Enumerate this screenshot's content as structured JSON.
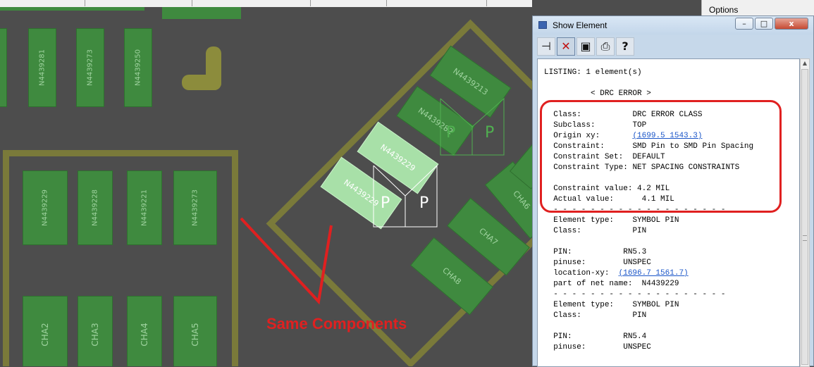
{
  "canvas": {
    "left_pads": [
      "N4439281",
      "N4439273",
      "N4439250"
    ],
    "middle_pads": [
      "N4439229",
      "N4439228",
      "N4439221",
      "N4439273"
    ],
    "bottom_pads": [
      "CHA2",
      "CHA3",
      "CHA4",
      "CHA5"
    ],
    "rotated_pads": {
      "highlighted": [
        "N4439229",
        "N4439229"
      ],
      "upper": [
        "N4439213",
        "N4439282"
      ],
      "cha": [
        "CHA6",
        "CHA7",
        "CHA8"
      ],
      "pin_glyph": "P"
    },
    "annotation": "Same Components",
    "colors": {
      "pad": "#3f8a3f",
      "highlight": "#a8e0a8",
      "outline": "#7a7a3a",
      "annotation": "#e02020"
    }
  },
  "options_label": "Options",
  "dialog": {
    "title": "Show Element",
    "window_buttons": {
      "minimize": "–",
      "maximize": "□",
      "close": "x"
    },
    "toolbar": [
      {
        "name": "pin",
        "glyph": "⊣"
      },
      {
        "name": "close",
        "glyph": "✕"
      },
      {
        "name": "save",
        "glyph": "▣"
      },
      {
        "name": "print",
        "glyph": "⎙"
      },
      {
        "name": "help",
        "glyph": "?"
      }
    ],
    "listing": {
      "header": "LISTING: 1 element(s)",
      "section": "< DRC ERROR >",
      "class_label": "Class:",
      "class_value": "DRC ERROR CLASS",
      "subclass_label": "Subclass:",
      "subclass_value": "TOP",
      "origin_label": "Origin xy:",
      "origin_value": "(1699.5 1543.3)",
      "constraint_label": "Constraint:",
      "constraint_value": "SMD Pin to SMD Pin Spacing",
      "constraint_set_label": "Constraint Set:",
      "constraint_set_value": "DEFAULT",
      "constraint_type_label": "Constraint Type:",
      "constraint_type_value": "NET SPACING CONSTRAINTS",
      "constraint_val_label": "Constraint value:",
      "constraint_val_value": "4.2 MIL",
      "actual_label": "Actual value:",
      "actual_value": "4.1 MIL",
      "separator": "- - - - - - - - - - - - - - - - - - -",
      "el1_type_label": "Element type:",
      "el1_type_value": "SYMBOL PIN",
      "el1_class_label": "Class:",
      "el1_class_value": "PIN",
      "pin1_label": "PIN:",
      "pin1_value": "RN5.3",
      "pinuse1_label": "pinuse:",
      "pinuse1_value": "UNSPEC",
      "loc1_label": "location-xy:",
      "loc1_value": "(1696.7 1561.7)",
      "net1_label": "part of net name:",
      "net1_value": "N4439229",
      "el2_type_label": "Element type:",
      "el2_type_value": "SYMBOL PIN",
      "el2_class_label": "Class:",
      "el2_class_value": "PIN",
      "pin2_label": "PIN:",
      "pin2_value": "RN5.4",
      "pinuse2_label": "pinuse:",
      "pinuse2_value": "UNSPEC"
    }
  }
}
